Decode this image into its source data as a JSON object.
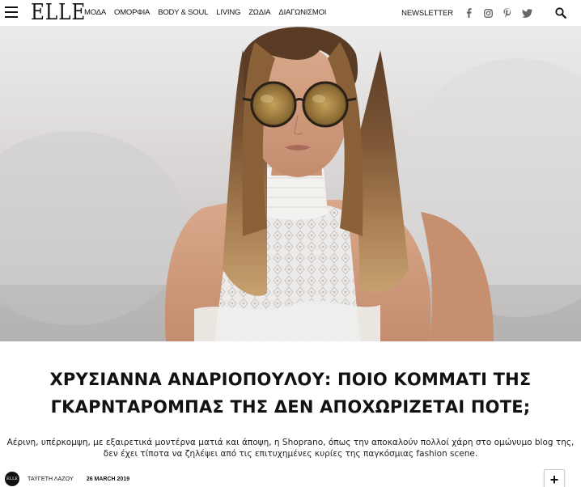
{
  "header": {
    "logo": "ELLE",
    "nav": [
      "ΜΟΔΑ",
      "ΟΜΟΡΦΙΑ",
      "BODY & SOUL",
      "LIVING",
      "ΖΩΔΙΑ",
      "ΔΙΑΓΩΝΙΣΜΟΙ"
    ],
    "newsletter": "NEWSLETTER",
    "social_icons": [
      "facebook-icon",
      "instagram-icon",
      "pinterest-icon",
      "twitter-icon"
    ],
    "search_icon": "search-icon"
  },
  "article": {
    "title_line1": "ΧΡΥΣΙΑΝΝΑ ΑΝΔΡΙΟΠΟΥΛΟΥ: ΠΟΙΟ ΚΟΜΜΑΤΙ ΤΗΣ",
    "title_line2": "ΓΚΑΡΝΤΑΡΟΜΠΑΣ ΤΗΣ ΔΕΝ ΑΠΟΧΩΡΙΖΕΤΑΙ ΠΟΤΕ;",
    "lead_line1": "Αέρινη, υπέρκομψη, με εξαιρετικά μοντέρνα ματιά και άποψη, η Shoprano, όπως την αποκαλούν πολλοί χάρη στο ομώνυμο blog της,",
    "lead_line2": "δεν έχει τίποτα να ζηλέψει από τις επιτυχημένες κυρίες της παγκόσμιας fashion scene.",
    "author": "ΤΑΫΓΕΤΗ ΛΑΖΟΥ",
    "date": "26 MARCH 2019",
    "avatar_text": "ELLE",
    "plus": "+"
  }
}
